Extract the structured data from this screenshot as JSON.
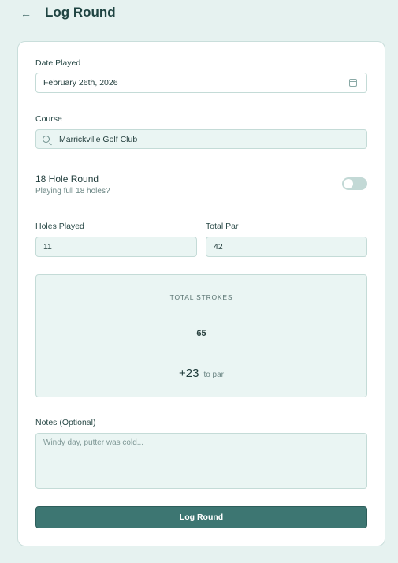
{
  "header": {
    "title": "Log Round",
    "back_icon": "arrow-left-icon"
  },
  "form": {
    "date": {
      "label": "Date Played",
      "value": "February 26th, 2026",
      "icon": "calendar-icon"
    },
    "course": {
      "label": "Course",
      "value": "Marrickville Golf Club",
      "icon": "search-icon"
    },
    "full_round": {
      "title": "18 Hole Round",
      "subtitle": "Playing full 18 holes?",
      "enabled": false
    },
    "holes_played": {
      "label": "Holes Played",
      "value": "11"
    },
    "total_par": {
      "label": "Total Par",
      "value": "42"
    },
    "summary": {
      "label": "TOTAL STROKES",
      "strokes": "65",
      "to_par_value": "+23",
      "to_par_text": "to par"
    },
    "notes": {
      "label": "Notes (Optional)",
      "placeholder": "Windy day, putter was cold..."
    },
    "submit_label": "Log Round"
  }
}
